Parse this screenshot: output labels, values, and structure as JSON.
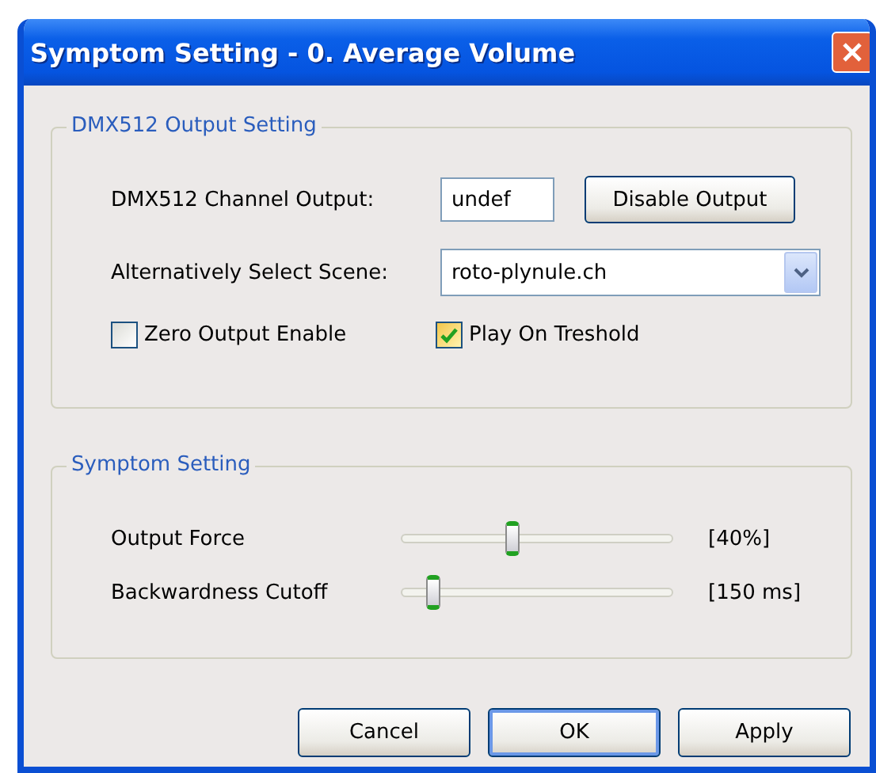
{
  "window": {
    "title": "Symptom Setting - 0. Average Volume"
  },
  "output_group": {
    "title": "DMX512 Output Setting",
    "channel_label": "DMX512 Channel Output:",
    "channel_value": "undef",
    "disable_button": "Disable Output",
    "scene_label": "Alternatively Select Scene:",
    "scene_value": "roto-plynule.ch",
    "checkboxes": [
      {
        "label": "Zero Output Enable",
        "checked": false
      },
      {
        "label": "Play On Treshold",
        "checked": true
      }
    ]
  },
  "symptom_group": {
    "title": "Symptom Setting",
    "sliders": [
      {
        "label": "Output Force",
        "level": 0.41,
        "reading": "[40%]"
      },
      {
        "label": "Backwardness Cutoff",
        "level": 0.12,
        "reading": "[150 ms]"
      }
    ]
  },
  "buttons": [
    {
      "label": "Cancel",
      "default": false
    },
    {
      "label": "OK",
      "default": true
    },
    {
      "label": "Apply",
      "default": false
    }
  ]
}
